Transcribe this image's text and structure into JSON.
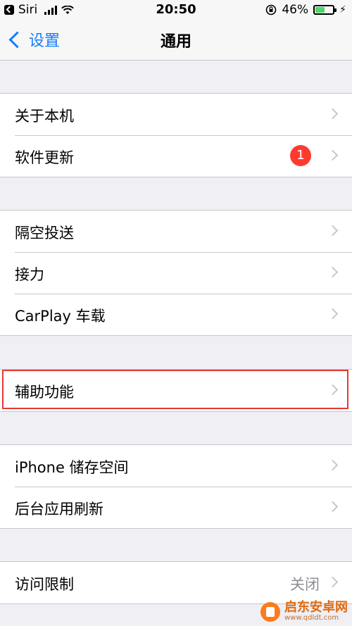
{
  "status_bar": {
    "carrier": "Siri",
    "time": "20:50",
    "battery_percent": "46%",
    "battery_level": 0.46,
    "battery_color": "#4cd964"
  },
  "navbar": {
    "back_label": "设置",
    "title": "通用",
    "accent_color": "#157efb"
  },
  "groups": [
    {
      "rows": [
        {
          "label": "关于本机"
        },
        {
          "label": "软件更新",
          "badge": "1"
        }
      ]
    },
    {
      "rows": [
        {
          "label": "隔空投送"
        },
        {
          "label": "接力"
        },
        {
          "label": "CarPlay 车载"
        }
      ]
    },
    {
      "rows": [
        {
          "label": "辅助功能",
          "highlighted": true
        }
      ]
    },
    {
      "rows": [
        {
          "label": "iPhone 储存空间"
        },
        {
          "label": "后台应用刷新"
        }
      ]
    },
    {
      "rows": [
        {
          "label": "访问限制",
          "value": "关闭"
        }
      ]
    }
  ],
  "watermark": {
    "name": "启东安卓网",
    "url": "www.qdldt.com"
  }
}
